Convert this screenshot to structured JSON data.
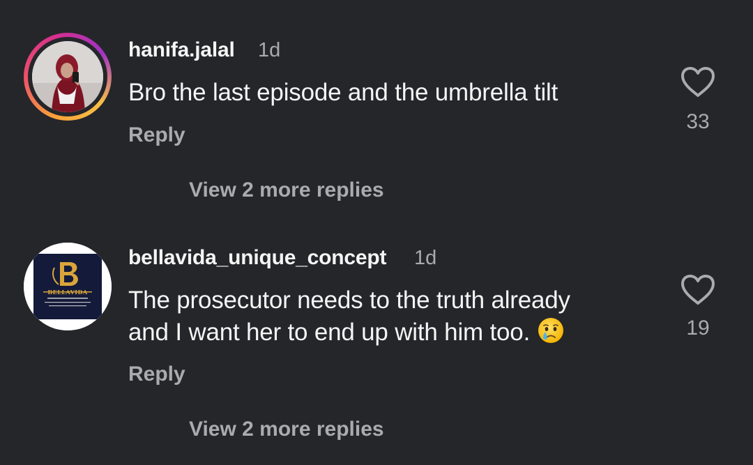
{
  "comments": [
    {
      "username": "hanifa.jalal",
      "time": "1d",
      "text": "Bro the last episode and the umbrella tilt",
      "reply_label": "Reply",
      "like_count": "33",
      "view_replies_label": "View 2 more replies"
    },
    {
      "username": "bellavida_unique_concept",
      "time": "1d",
      "text_line1": "The prosecutor needs to the truth already",
      "text_line2": "and I want her to end up with him too.",
      "reply_label": "Reply",
      "like_count": "19",
      "view_replies_label": "View 2 more replies",
      "logo_text": "BELLAVIDA",
      "emoji_name": "crying-face-emoji"
    }
  ],
  "colors": {
    "background": "#25262a",
    "primary_text": "#f5f5f5",
    "secondary_text": "#a8abb0"
  }
}
